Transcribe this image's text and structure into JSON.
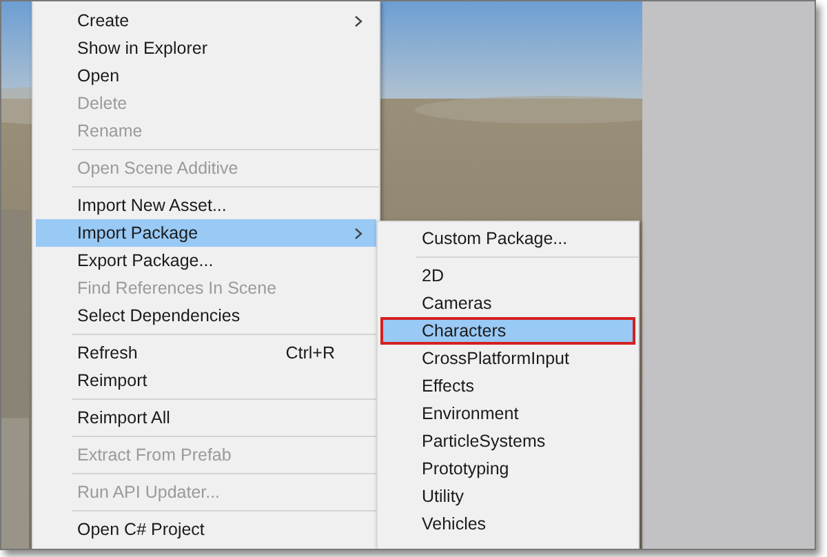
{
  "context_menu": {
    "items": [
      {
        "kind": "item",
        "label": "Create",
        "disabled": false,
        "selected": false,
        "has_submenu": true
      },
      {
        "kind": "item",
        "label": "Show in Explorer",
        "disabled": false,
        "selected": false
      },
      {
        "kind": "item",
        "label": "Open",
        "disabled": false,
        "selected": false
      },
      {
        "kind": "item",
        "label": "Delete",
        "disabled": true,
        "selected": false
      },
      {
        "kind": "item",
        "label": "Rename",
        "disabled": true,
        "selected": false
      },
      {
        "kind": "separator"
      },
      {
        "kind": "item",
        "label": "Open Scene Additive",
        "disabled": true,
        "selected": false
      },
      {
        "kind": "separator"
      },
      {
        "kind": "item",
        "label": "Import New Asset...",
        "disabled": false,
        "selected": false
      },
      {
        "kind": "item",
        "label": "Import Package",
        "disabled": false,
        "selected": true,
        "has_submenu": true
      },
      {
        "kind": "item",
        "label": "Export Package...",
        "disabled": false,
        "selected": false
      },
      {
        "kind": "item",
        "label": "Find References In Scene",
        "disabled": true,
        "selected": false
      },
      {
        "kind": "item",
        "label": "Select Dependencies",
        "disabled": false,
        "selected": false
      },
      {
        "kind": "separator"
      },
      {
        "kind": "item",
        "label": "Refresh",
        "shortcut": "Ctrl+R",
        "disabled": false,
        "selected": false
      },
      {
        "kind": "item",
        "label": "Reimport",
        "disabled": false,
        "selected": false
      },
      {
        "kind": "separator"
      },
      {
        "kind": "item",
        "label": "Reimport All",
        "disabled": false,
        "selected": false
      },
      {
        "kind": "separator"
      },
      {
        "kind": "item",
        "label": "Extract From Prefab",
        "disabled": true,
        "selected": false
      },
      {
        "kind": "separator"
      },
      {
        "kind": "item",
        "label": "Run API Updater...",
        "disabled": true,
        "selected": false
      },
      {
        "kind": "separator"
      },
      {
        "kind": "item",
        "label": "Open C# Project",
        "disabled": false,
        "selected": false
      }
    ]
  },
  "submenu": {
    "items": [
      {
        "kind": "item",
        "label": "Custom Package...",
        "selected": false,
        "outlined": false
      },
      {
        "kind": "separator"
      },
      {
        "kind": "item",
        "label": "2D",
        "selected": false,
        "outlined": false
      },
      {
        "kind": "item",
        "label": "Cameras",
        "selected": false,
        "outlined": false
      },
      {
        "kind": "item",
        "label": "Characters",
        "selected": true,
        "outlined": true
      },
      {
        "kind": "item",
        "label": "CrossPlatformInput",
        "selected": false,
        "outlined": false
      },
      {
        "kind": "item",
        "label": "Effects",
        "selected": false,
        "outlined": false
      },
      {
        "kind": "item",
        "label": "Environment",
        "selected": false,
        "outlined": false
      },
      {
        "kind": "item",
        "label": "ParticleSystems",
        "selected": false,
        "outlined": false
      },
      {
        "kind": "item",
        "label": "Prototyping",
        "selected": false,
        "outlined": false
      },
      {
        "kind": "item",
        "label": "Utility",
        "selected": false,
        "outlined": false
      },
      {
        "kind": "item",
        "label": "Vehicles",
        "selected": false,
        "outlined": false
      }
    ]
  }
}
